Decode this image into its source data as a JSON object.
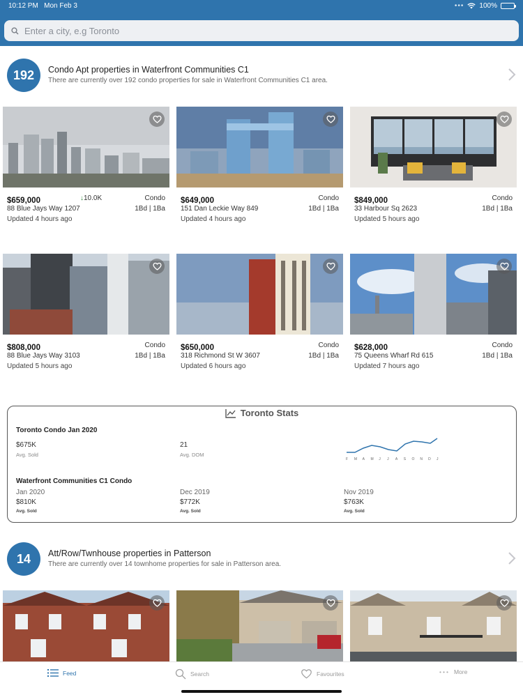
{
  "status_bar": {
    "time": "10:12 PM",
    "date": "Mon Feb 3",
    "battery": "100%"
  },
  "search": {
    "placeholder": "Enter a city, e.g Toronto"
  },
  "section1": {
    "count": "192",
    "title": "Condo Apt properties in Waterfront Communities C1",
    "subtitle": "There are currently over 192 condo properties for sale in Waterfront Communities C1 area.",
    "listings": [
      {
        "price": "$659,000",
        "drop": "10.0K",
        "type": "Condo",
        "address": "88 Blue Jays Way 1207",
        "beds": "1Bd | 1Ba",
        "updated": "Updated 4 hours ago"
      },
      {
        "price": "$649,000",
        "type": "Condo",
        "address": "151 Dan Leckie Way 849",
        "beds": "1Bd | 1Ba",
        "updated": "Updated 4 hours ago"
      },
      {
        "price": "$849,000",
        "type": "Condo",
        "address": "33 Harbour Sq 2623",
        "beds": "1Bd | 1Ba",
        "updated": "Updated 5 hours ago"
      },
      {
        "price": "$808,000",
        "type": "Condo",
        "address": "88 Blue Jays Way 3103",
        "beds": "1Bd | 1Ba",
        "updated": "Updated 5 hours ago"
      },
      {
        "price": "$650,000",
        "type": "Condo",
        "address": "318 Richmond St W 3607",
        "beds": "1Bd | 1Ba",
        "updated": "Updated 6 hours ago"
      },
      {
        "price": "$628,000",
        "type": "Condo",
        "address": "75 Queens Wharf Rd 615",
        "beds": "1Bd | 1Ba",
        "updated": "Updated 7 hours ago"
      }
    ]
  },
  "stats": {
    "title": "Toronto Stats",
    "block1_label": "Toronto Condo Jan 2020",
    "avg_sold": "$675K",
    "avg_sold_cap": "Avg. Sold",
    "avg_dom": "21",
    "avg_dom_cap": "Avg. DOM",
    "sparkline_months": [
      "F",
      "M",
      "A",
      "M",
      "J",
      "J",
      "A",
      "S",
      "O",
      "N",
      "D",
      "J"
    ],
    "block2_label": "Waterfront Communities C1 Condo",
    "history": [
      {
        "month": "Jan 2020",
        "value": "$810K",
        "cap": "Avg. Sold"
      },
      {
        "month": "Dec 2019",
        "value": "$772K",
        "cap": "Avg. Sold"
      },
      {
        "month": "Nov 2019",
        "value": "$763K",
        "cap": "Avg. Sold"
      }
    ]
  },
  "section2": {
    "count": "14",
    "title": "Att/Row/Twnhouse properties in Patterson",
    "subtitle": "There are currently over 14 townhome properties for sale in Patterson area."
  },
  "tabs": [
    {
      "label": "Feed",
      "icon": "list-icon",
      "active": true
    },
    {
      "label": "Search",
      "icon": "search-icon",
      "active": false
    },
    {
      "label": "Favourites",
      "icon": "heart-icon",
      "active": false
    },
    {
      "label": "More",
      "icon": "more-dots-icon",
      "active": false
    }
  ],
  "colors": {
    "brand_blue": "#2f74ad",
    "price_drop_green": "#2e8b3a",
    "sparkline": "#2f74ad"
  }
}
